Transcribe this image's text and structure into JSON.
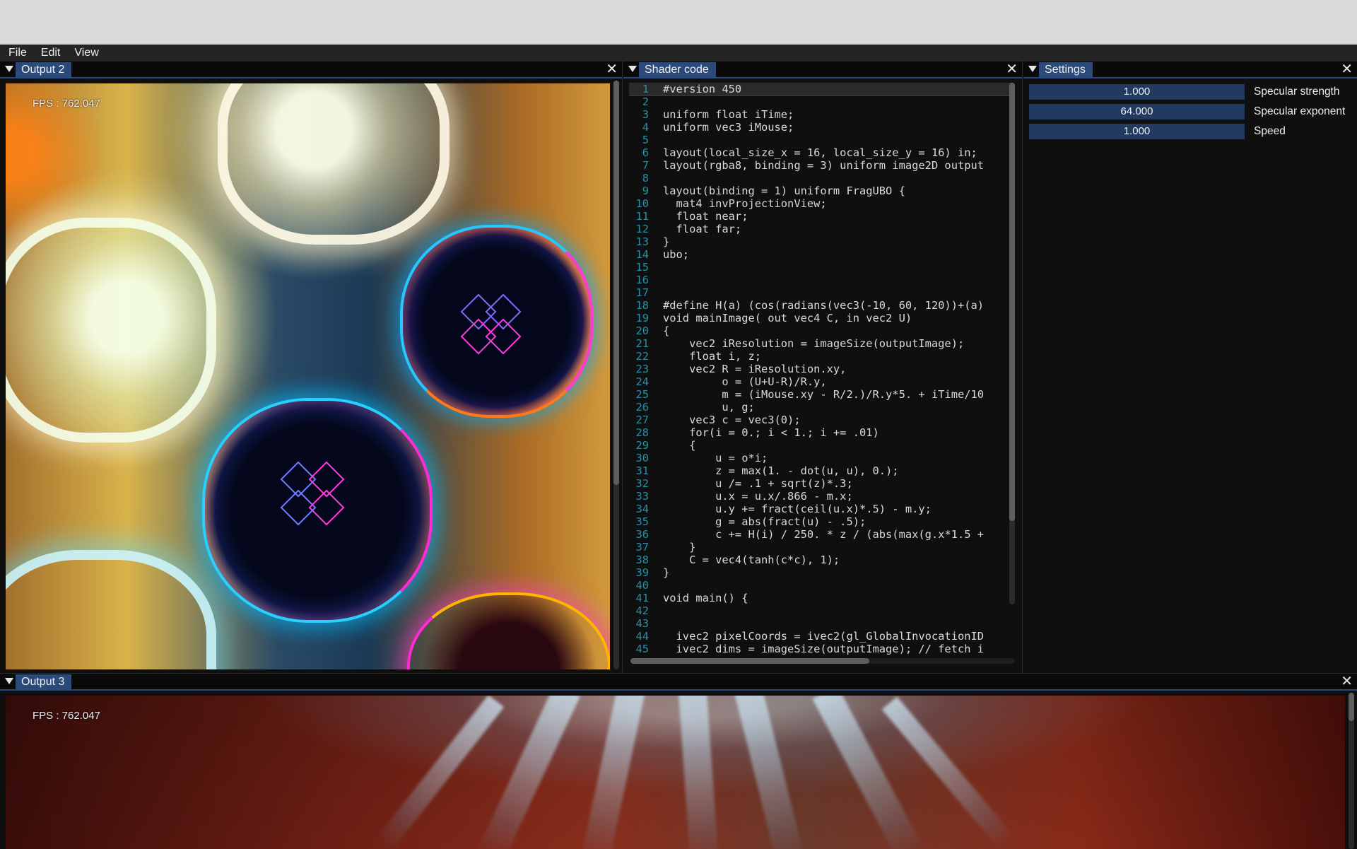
{
  "menubar": {
    "items": [
      "File",
      "Edit",
      "View"
    ]
  },
  "panels": {
    "output2": {
      "title": "Output 2",
      "fps": "FPS : 762.047"
    },
    "shader": {
      "title": "Shader code"
    },
    "settings": {
      "title": "Settings",
      "rows": [
        {
          "value": "1.000",
          "label": "Specular strength"
        },
        {
          "value": "64.000",
          "label": "Specular exponent"
        },
        {
          "value": "1.000",
          "label": "Speed"
        }
      ]
    },
    "output3": {
      "title": "Output 3",
      "fps": "FPS : 762.047"
    }
  },
  "code_lines": [
    "#version 450",
    "",
    "uniform float iTime;",
    "uniform vec3 iMouse;",
    "",
    "layout(local_size_x = 16, local_size_y = 16) in;",
    "layout(rgba8, binding = 3) uniform image2D output",
    "",
    "layout(binding = 1) uniform FragUBO {",
    "  mat4 invProjectionView;",
    "  float near;",
    "  float far;",
    "}",
    "ubo;",
    "",
    "",
    "",
    "#define H(a) (cos(radians(vec3(-10, 60, 120))+(a)",
    "void mainImage( out vec4 C, in vec2 U)",
    "{",
    "    vec2 iResolution = imageSize(outputImage);",
    "    float i, z;",
    "    vec2 R = iResolution.xy,",
    "         o = (U+U-R)/R.y,",
    "         m = (iMouse.xy - R/2.)/R.y*5. + iTime/10",
    "         u, g;",
    "    vec3 c = vec3(0);",
    "    for(i = 0.; i < 1.; i += .01)",
    "    {",
    "        u = o*i;",
    "        z = max(1. - dot(u, u), 0.);",
    "        u /= .1 + sqrt(z)*.3;",
    "        u.x = u.x/.866 - m.x;",
    "        u.y += fract(ceil(u.x)*.5) - m.y;",
    "        g = abs(fract(u) - .5);",
    "        c += H(i) / 250. * z / (abs(max(g.x*1.5 +",
    "    }",
    "    C = vec4(tanh(c*c), 1);",
    "}",
    "",
    "void main() {",
    "  ",
    "",
    "  ivec2 pixelCoords = ivec2(gl_GlobalInvocationID",
    "  ivec2 dims = imageSize(outputImage); // fetch i"
  ]
}
